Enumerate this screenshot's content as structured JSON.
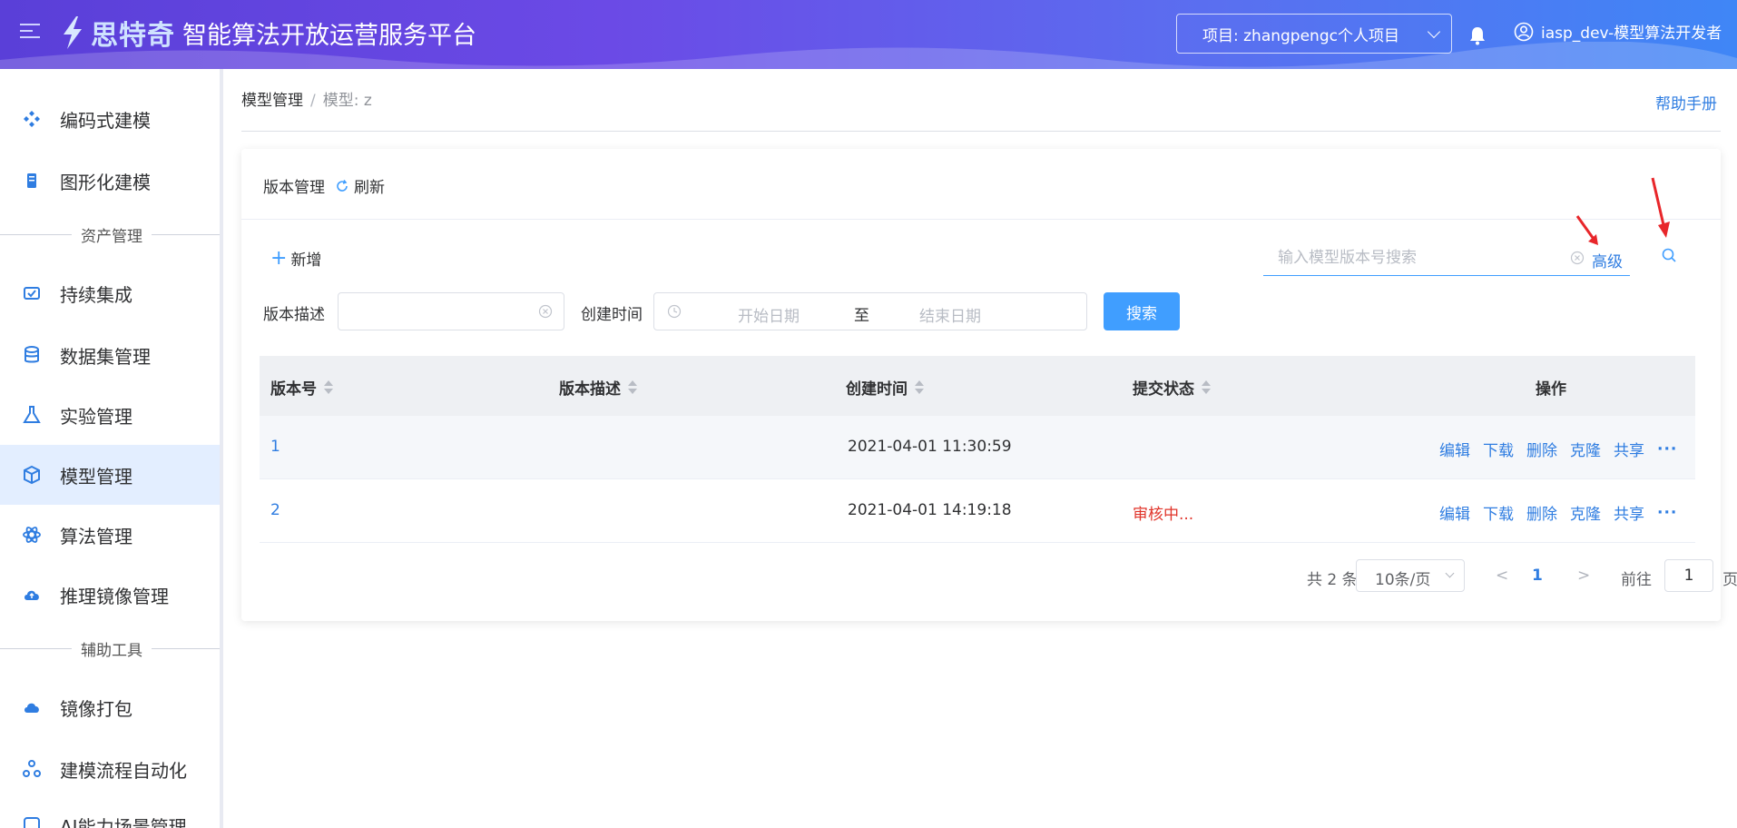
{
  "header": {
    "brand": "思特奇",
    "title": "智能算法开放运营服务平台",
    "project": "项目: zhangpengc个人项目",
    "user": "iasp_dev-模型算法开发者"
  },
  "sidebar": {
    "items": [
      {
        "label": "编码式建模",
        "icon": "code-model-icon"
      },
      {
        "label": "图形化建模",
        "icon": "graphic-model-icon"
      },
      {
        "label": "持续集成",
        "icon": "ci-icon"
      },
      {
        "label": "数据集管理",
        "icon": "dataset-icon"
      },
      {
        "label": "实验管理",
        "icon": "flask-icon"
      },
      {
        "label": "模型管理",
        "icon": "cube-icon"
      },
      {
        "label": "算法管理",
        "icon": "atom-icon"
      },
      {
        "label": "推理镜像管理",
        "icon": "cloud-upload-icon"
      },
      {
        "label": "镜像打包",
        "icon": "cloud-package-icon"
      },
      {
        "label": "建模流程自动化",
        "icon": "workflow-icon"
      },
      {
        "label": "AI能力场景管理",
        "icon": "scene-icon"
      }
    ],
    "sections": [
      "资产管理",
      "辅助工具"
    ],
    "active": "模型管理"
  },
  "breadcrumb": {
    "root": "模型管理",
    "current": "模型: z"
  },
  "help": "帮助手册",
  "card": {
    "title": "版本管理",
    "refresh": "刷新",
    "add": "新增",
    "search_placeholder": "输入模型版本号搜索",
    "advanced": "高级",
    "filters": {
      "desc_label": "版本描述",
      "time_label": "创建时间",
      "start_placeholder": "开始日期",
      "to": "至",
      "end_placeholder": "结束日期",
      "search_button": "搜索"
    }
  },
  "table": {
    "columns": [
      "版本号",
      "版本描述",
      "创建时间",
      "提交状态",
      "操作"
    ],
    "rows": [
      {
        "version": "1",
        "desc": "",
        "created": "2021-04-01 11:30:59",
        "status": ""
      },
      {
        "version": "2",
        "desc": "",
        "created": "2021-04-01 14:19:18",
        "status": "审核中..."
      }
    ],
    "actions": [
      "编辑",
      "下载",
      "删除",
      "克隆",
      "共享",
      "···"
    ]
  },
  "pager": {
    "total": "共 2 条",
    "page_size": "10条/页",
    "prev": "<",
    "current": "1",
    "next": ">",
    "goto": "前往",
    "jump_value": "1",
    "page_unit": "页"
  },
  "colors": {
    "primary": "#409eff",
    "link": "#2f7de1",
    "danger": "#e0342a",
    "annotation": "#e8262a"
  }
}
